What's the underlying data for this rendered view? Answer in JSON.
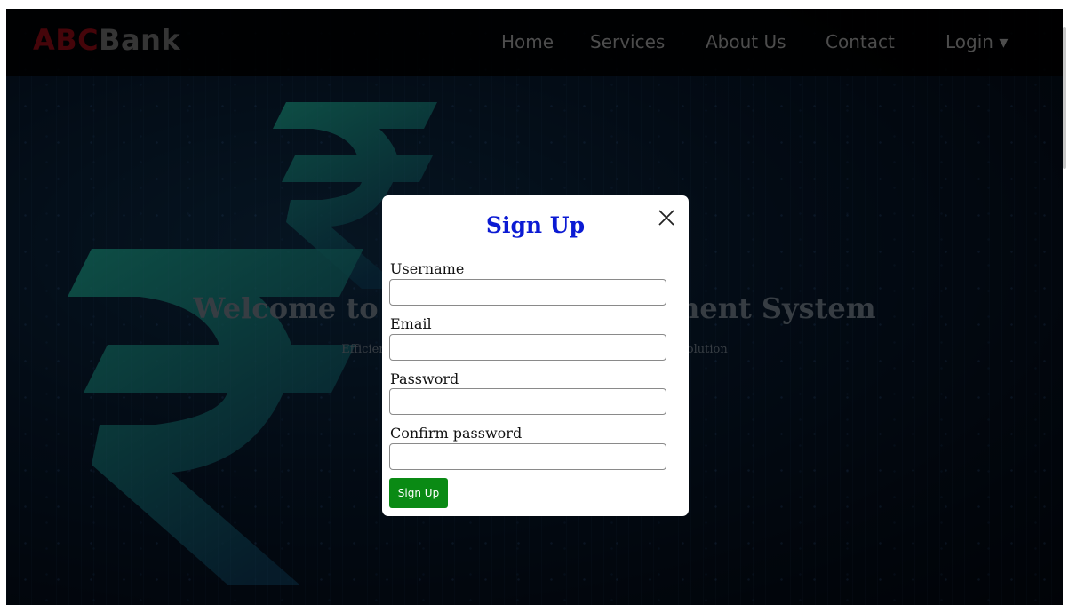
{
  "navbar": {
    "brand_part1": "ABC",
    "brand_part2": "Bank",
    "links": [
      "Home",
      "Services",
      "About Us",
      "Contact",
      "Login ▾"
    ]
  },
  "hero": {
    "title": "Welcome to the Bank Management System",
    "subtitle": "Efficiently manage your bank accounts with our software solution"
  },
  "modal": {
    "title": "Sign Up",
    "fields": [
      {
        "label": "Username",
        "value": "",
        "placeholder": ""
      },
      {
        "label": "Email",
        "value": "",
        "placeholder": ""
      },
      {
        "label": "Password",
        "value": "",
        "placeholder": ""
      },
      {
        "label": "Confirm password",
        "value": "",
        "placeholder": ""
      }
    ],
    "submit_label": "Sign Up"
  },
  "colors": {
    "brand_primary": "#8b0b14",
    "modal_title": "#0b1ad3",
    "submit_button": "#0a8a14",
    "rupee_gradient_start": "#1fb39a",
    "rupee_gradient_end": "#0d3e5c"
  },
  "icons": {
    "close": "close-icon",
    "rupee": "rupee-icon"
  }
}
